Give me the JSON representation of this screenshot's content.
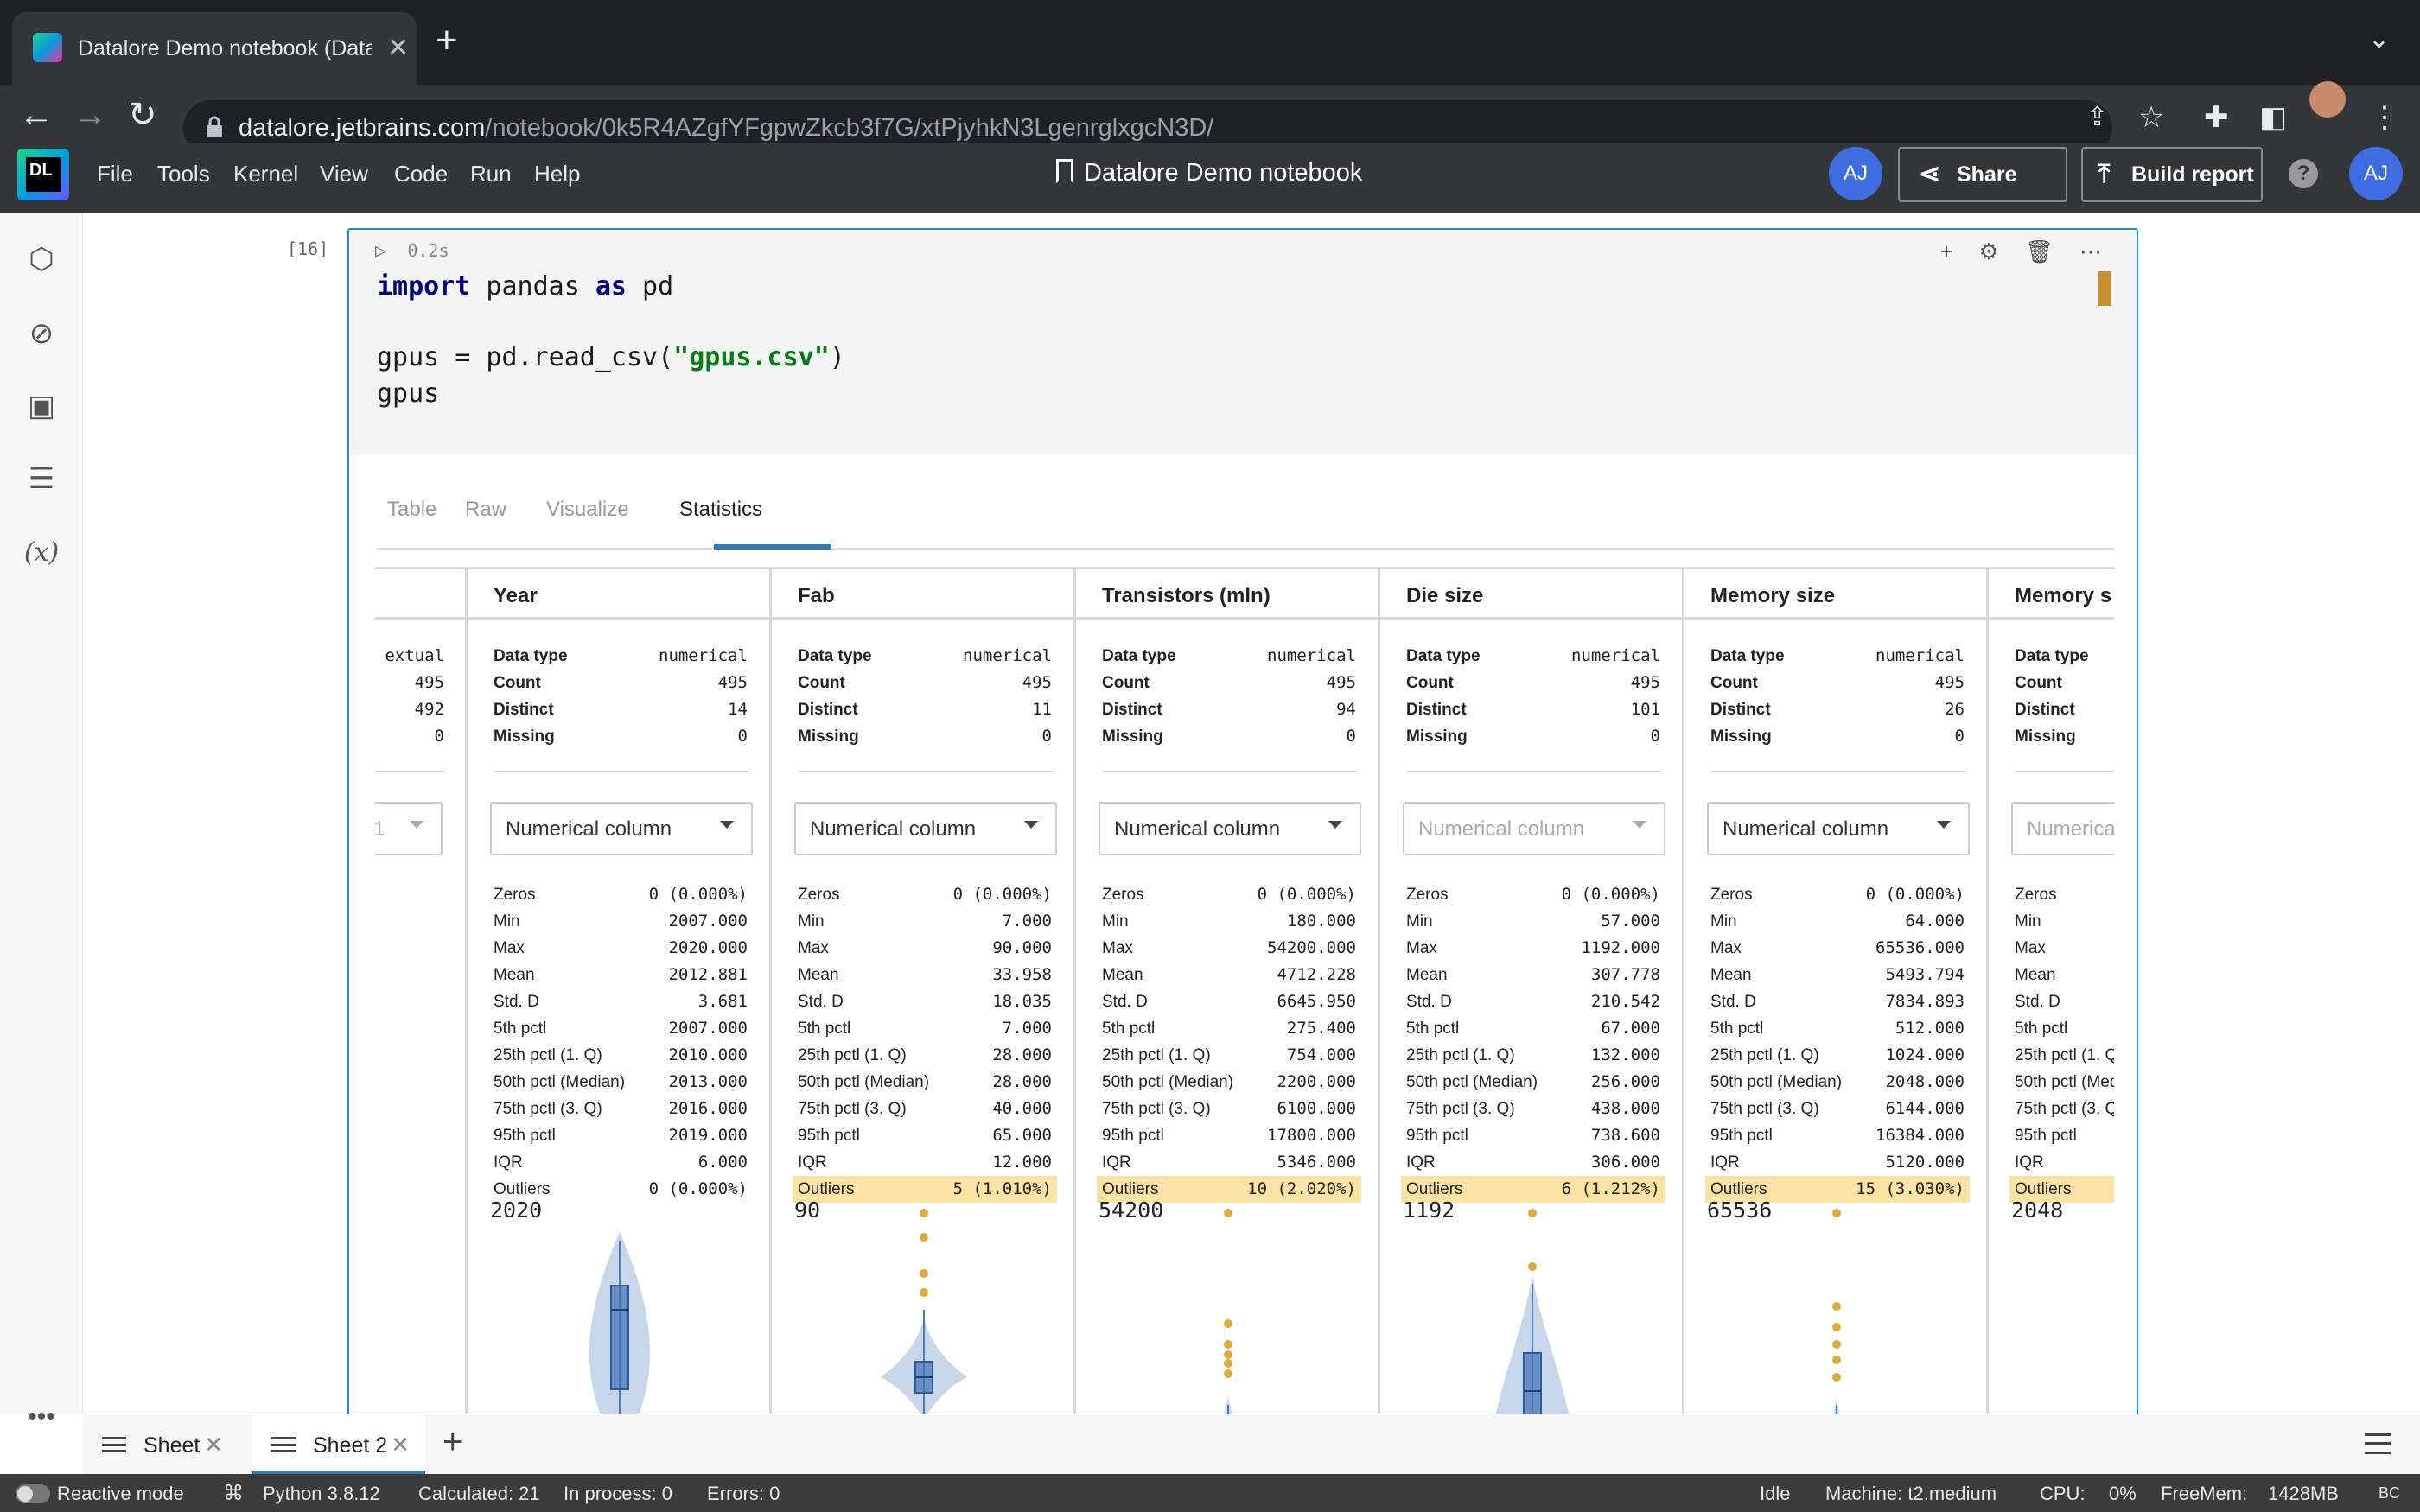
{
  "browser": {
    "tab_title": "Datalore Demo notebook (Data",
    "url_domain": "datalore.jetbrains.com",
    "url_path": "/notebook/0k5R4AZgfYFgpwZkcb3f7G/xtPjyhkN3LgenrglxgcN3D/"
  },
  "app": {
    "menu": [
      "File",
      "Tools",
      "Kernel",
      "View",
      "Code",
      "Run",
      "Help"
    ],
    "notebook_title": "Datalore Demo notebook",
    "avatar_initials": "AJ",
    "share_label": "Share",
    "build_report_label": "Build report",
    "help_label": "?",
    "logo_text": "DL"
  },
  "cell": {
    "exec_count": "[16]",
    "run_time": "0.2s",
    "code": {
      "kw_import": "import",
      "mod": " pandas ",
      "kw_as": "as",
      "alias": " pd",
      "l3_pre": "gpus = pd.read_csv(",
      "l3_str": "\"gpus.csv\"",
      "l3_post": ")",
      "l4": "gpus"
    },
    "output_tabs": [
      "Table",
      "Raw",
      "Visualize",
      "Statistics"
    ],
    "active_tab": "Statistics"
  },
  "stats": {
    "partial_left": {
      "dtype_tail": "extual",
      "count": "495",
      "distinct": "492",
      "missing": "0",
      "dd_tail": "1"
    },
    "labels": {
      "data_type": "Data type",
      "count": "Count",
      "distinct": "Distinct",
      "missing": "Missing",
      "zeros": "Zeros",
      "min": "Min",
      "max": "Max",
      "mean": "Mean",
      "std": "Std. D",
      "p5": "5th pctl",
      "p25": "25th pctl (1. Q)",
      "p50": "50th pctl (Median)",
      "p75": "75th pctl (3. Q)",
      "p95": "95th pctl",
      "iqr": "IQR",
      "outliers": "Outliers"
    },
    "columns": [
      {
        "name": "Year",
        "dtype": "numerical",
        "count": "495",
        "distinct": "14",
        "missing": "0",
        "dropdown": "Numerical column",
        "dim": false,
        "zeros": "0 (0.000%)",
        "min": "2007.000",
        "max": "2020.000",
        "mean": "2012.881",
        "std": "3.681",
        "p5": "2007.000",
        "p25": "2010.000",
        "p50": "2013.000",
        "p75": "2016.000",
        "p95": "2019.000",
        "iqr": "6.000",
        "outliers": "0 (0.000%)",
        "outlier_hl": false,
        "vmax": "2020"
      },
      {
        "name": "Fab",
        "dtype": "numerical",
        "count": "495",
        "distinct": "11",
        "missing": "0",
        "dropdown": "Numerical column",
        "dim": false,
        "zeros": "0 (0.000%)",
        "min": "7.000",
        "max": "90.000",
        "mean": "33.958",
        "std": "18.035",
        "p5": "7.000",
        "p25": "28.000",
        "p50": "28.000",
        "p75": "40.000",
        "p95": "65.000",
        "iqr": "12.000",
        "outliers": "5 (1.010%)",
        "outlier_hl": true,
        "vmax": "90"
      },
      {
        "name": "Transistors (mln)",
        "dtype": "numerical",
        "count": "495",
        "distinct": "94",
        "missing": "0",
        "dropdown": "Numerical column",
        "dim": false,
        "zeros": "0 (0.000%)",
        "min": "180.000",
        "max": "54200.000",
        "mean": "4712.228",
        "std": "6645.950",
        "p5": "275.400",
        "p25": "754.000",
        "p50": "2200.000",
        "p75": "6100.000",
        "p95": "17800.000",
        "iqr": "5346.000",
        "outliers": "10 (2.020%)",
        "outlier_hl": true,
        "vmax": "54200"
      },
      {
        "name": "Die size",
        "dtype": "numerical",
        "count": "495",
        "distinct": "101",
        "missing": "0",
        "dropdown": "Numerical column",
        "dim": true,
        "zeros": "0 (0.000%)",
        "min": "57.000",
        "max": "1192.000",
        "mean": "307.778",
        "std": "210.542",
        "p5": "67.000",
        "p25": "132.000",
        "p50": "256.000",
        "p75": "438.000",
        "p95": "738.600",
        "iqr": "306.000",
        "outliers": "6 (1.212%)",
        "outlier_hl": true,
        "vmax": "1192"
      },
      {
        "name": "Memory size",
        "dtype": "numerical",
        "count": "495",
        "distinct": "26",
        "missing": "0",
        "dropdown": "Numerical column",
        "dim": false,
        "zeros": "0 (0.000%)",
        "min": "64.000",
        "max": "65536.000",
        "mean": "5493.794",
        "std": "7834.893",
        "p5": "512.000",
        "p25": "1024.000",
        "p50": "2048.000",
        "p75": "6144.000",
        "p95": "16384.000",
        "iqr": "5120.000",
        "outliers": "15 (3.030%)",
        "outlier_hl": true,
        "vmax": "65536"
      },
      {
        "name": "Memory s",
        "dtype": "",
        "count": "",
        "distinct": "",
        "missing": "",
        "dropdown": "Numerica",
        "dim": true,
        "zeros": "",
        "min": "",
        "max": "",
        "mean": "",
        "std": "",
        "p5": "",
        "p25": "",
        "p50": "",
        "p75": "",
        "p95": "",
        "iqr": "",
        "outliers": "",
        "outlier_hl": true,
        "vmax": "2048",
        "partial": true
      }
    ]
  },
  "sheets": [
    {
      "label": "Sheet",
      "active": false
    },
    {
      "label": "Sheet 2",
      "active": true
    }
  ],
  "statusbar": {
    "reactive": "Reactive mode",
    "python": "Python 3.8.12",
    "calculated": "Calculated: 21",
    "in_process": "In process: 0",
    "errors": "Errors: 0",
    "idle": "Idle",
    "machine": "Machine: t2.medium",
    "cpu_label": "CPU:",
    "cpu_value": "0%",
    "freemem_label": "FreeMem:",
    "freemem_value": "1428MB",
    "bc": "BC"
  },
  "colors": {
    "accent": "#1e8ae0",
    "outlier_highlight": "#fbe3a6",
    "violin": "#c8d6ea",
    "box": "#4a78b8",
    "outlier_dot": "#e0a93a"
  }
}
